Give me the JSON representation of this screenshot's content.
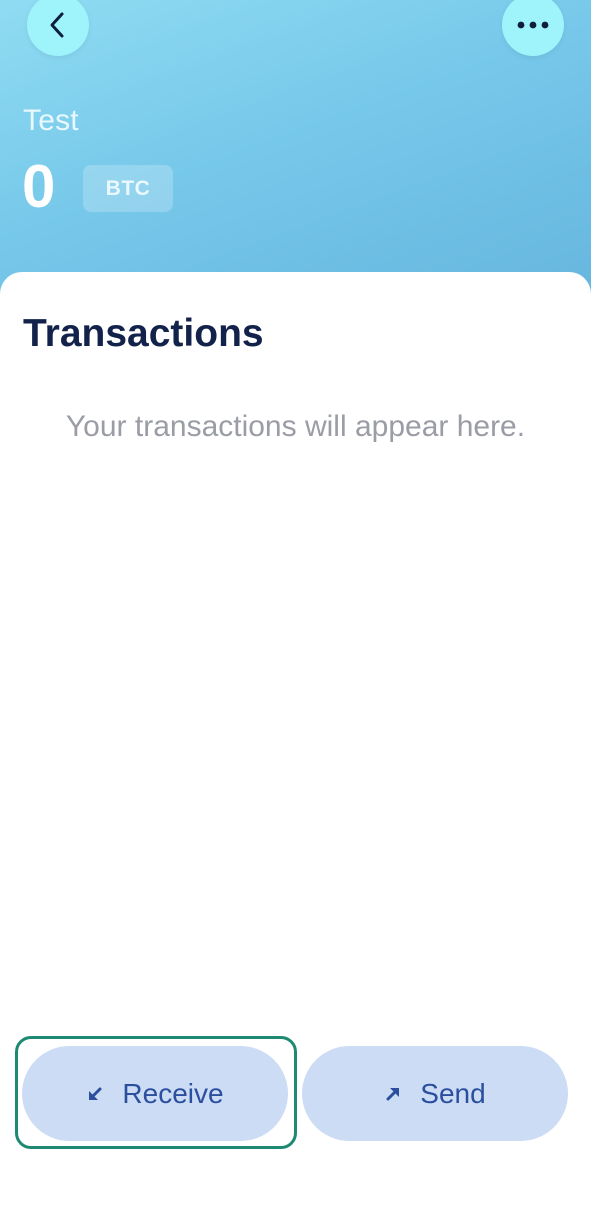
{
  "header": {
    "back_icon": "chevron-left-icon",
    "more_icon": "more-horizontal-icon",
    "wallet_name": "Test",
    "balance": "0",
    "unit": "BTC",
    "gradient_start": "#8fdcf2",
    "gradient_end": "#66b6df"
  },
  "transactions": {
    "title": "Transactions",
    "empty_message": "Your transactions will appear here."
  },
  "actions": {
    "receive_label": "Receive",
    "receive_icon": "arrow-down-left-icon",
    "send_label": "Send",
    "send_icon": "arrow-up-right-icon",
    "button_color": "#ccdcf5",
    "label_color": "#2b4f9e"
  },
  "highlight_color": "#1e8a72"
}
